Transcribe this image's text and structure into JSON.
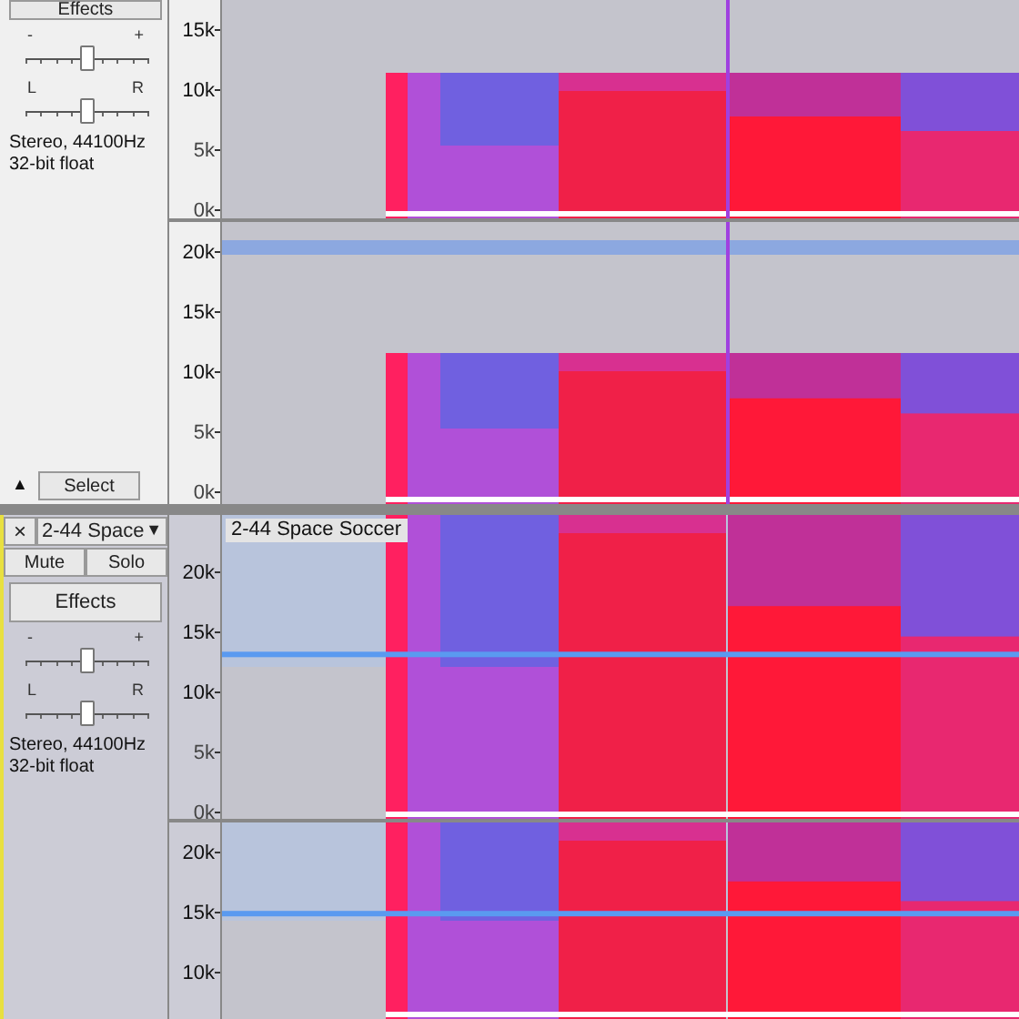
{
  "tracks": [
    {
      "selected": false,
      "effects": "Effects",
      "gain": {
        "min": "-",
        "max": "+",
        "level": 0.5
      },
      "pan": {
        "min": "L",
        "max": "R",
        "level": 0.5
      },
      "format": [
        "Stereo, 44100Hz",
        "32-bit float"
      ],
      "collapse": "▲",
      "select": "Select",
      "channels": [
        {
          "ticks": [
            "15k",
            "10k",
            "5k",
            "0k"
          ]
        },
        {
          "ticks": [
            "20k",
            "15k",
            "10k",
            "5k",
            "0k"
          ]
        }
      ]
    },
    {
      "selected": true,
      "close": "×",
      "name": "2-44 Space",
      "menu": "▼",
      "mute": "Mute",
      "solo": "Solo",
      "effects": "Effects",
      "gain": {
        "min": "-",
        "max": "+",
        "level": 0.5
      },
      "pan": {
        "min": "L",
        "max": "R",
        "level": 0.5
      },
      "format": [
        "Stereo, 44100Hz",
        "32-bit float"
      ],
      "title": "2-44 Space Soccer",
      "channels": [
        {
          "ticks": [
            "20k",
            "15k",
            "10k",
            "5k",
            "0k"
          ]
        },
        {
          "ticks": [
            "20k",
            "15k",
            "10k"
          ]
        }
      ]
    }
  ]
}
